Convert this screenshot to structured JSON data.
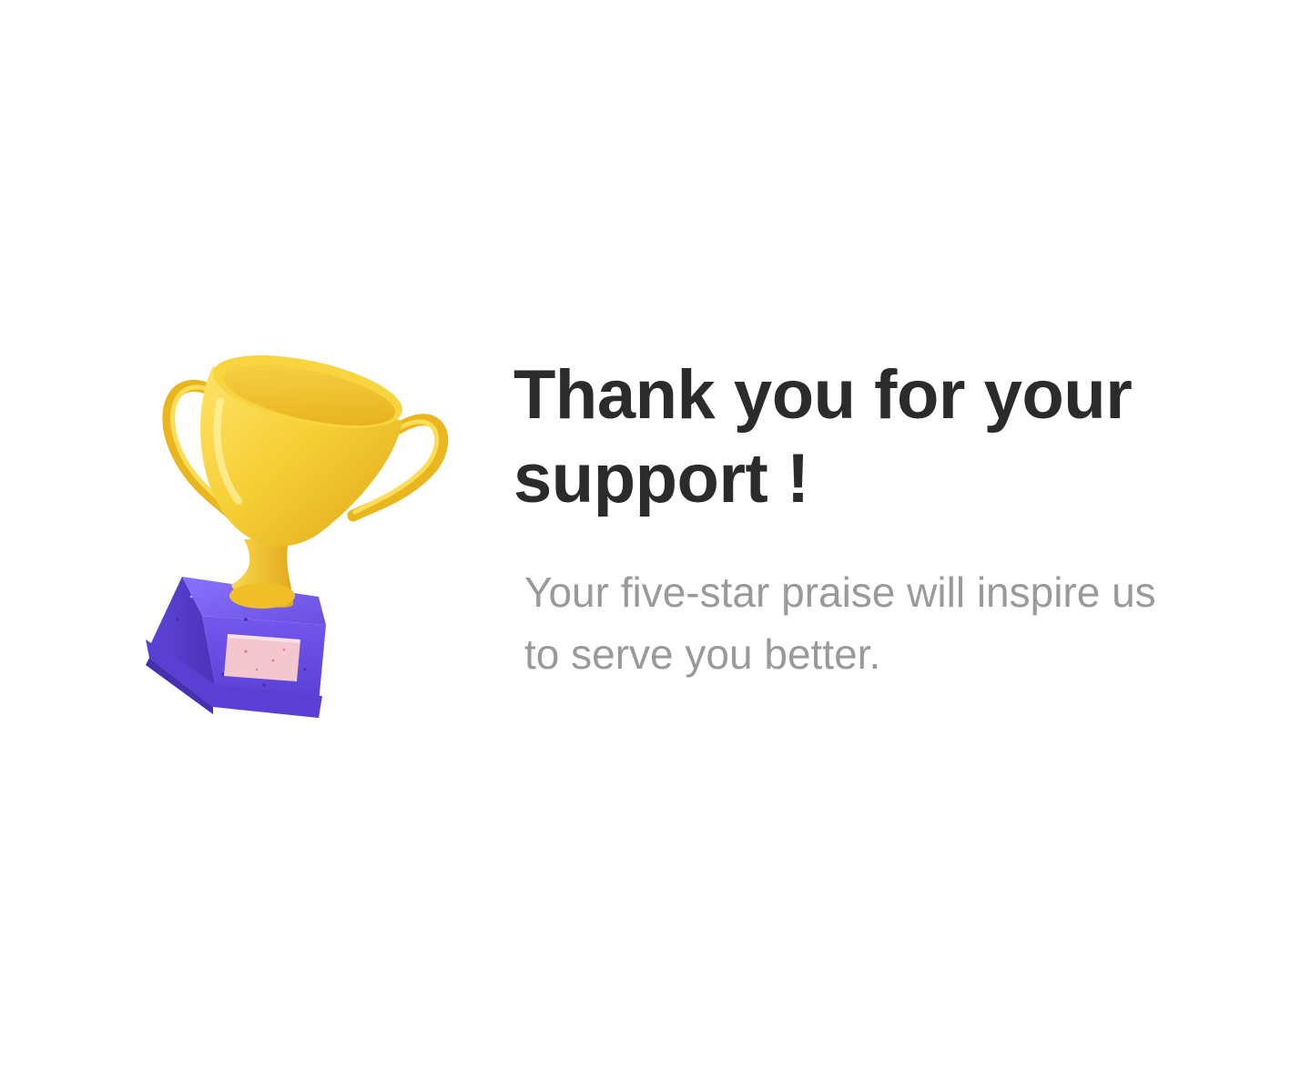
{
  "headline": {
    "line1": "Thank you for your",
    "line2": "support !"
  },
  "subtext": {
    "line1": "Your five-star praise will inspire us",
    "line2": "to serve you better."
  },
  "illustration": {
    "icon": "trophy-icon",
    "colors": {
      "cup": "#f3c52a",
      "base": "#6a4fe0",
      "plaque": "#f4c6cf"
    }
  },
  "colors": {
    "headline": "#2b2b2b",
    "subtext": "#9a9a9a",
    "background": "#ffffff"
  }
}
